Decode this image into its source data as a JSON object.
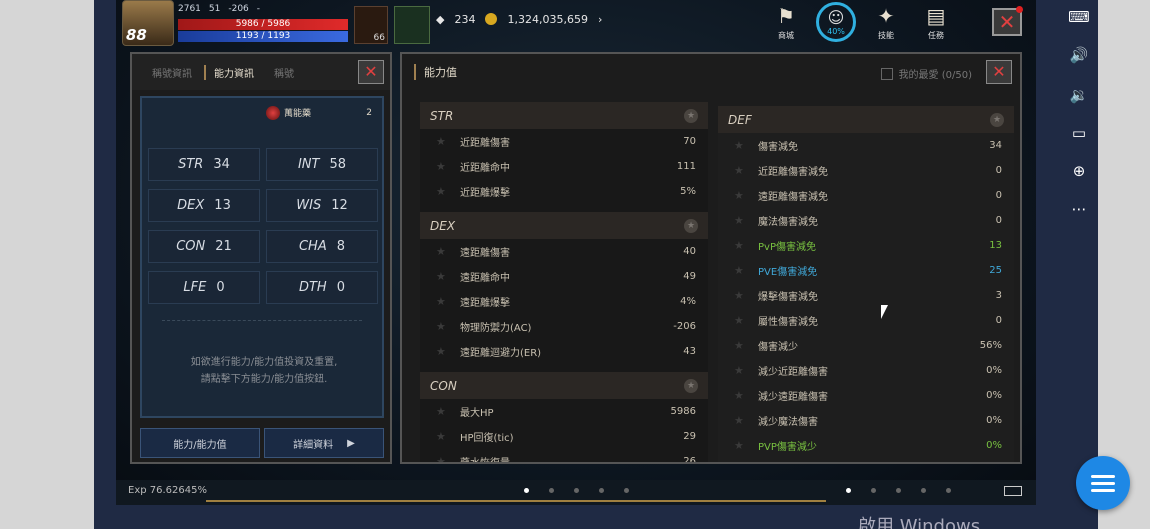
{
  "hud": {
    "level": "88",
    "stat1": "2761",
    "stat2": "51",
    "stat3": "-206",
    "stat4": "-",
    "hp": "5986 / 5986",
    "mp": "1193 / 1193",
    "potion_count": "66",
    "crystal": "234",
    "gold": "1,324,035,659",
    "menu": [
      {
        "label": "商城",
        "icon": "shop-icon"
      },
      {
        "label": "40%",
        "icon": "auto-icon"
      },
      {
        "label": "技能",
        "icon": "skill-icon"
      },
      {
        "label": "任務",
        "icon": "quest-icon"
      }
    ]
  },
  "left_panel": {
    "tabs": [
      "稱號資訊",
      "能力資訊",
      "稱號"
    ],
    "elixir_label": "萬能藥",
    "elixir_count": "2",
    "stats": [
      {
        "name": "STR",
        "value": "34"
      },
      {
        "name": "INT",
        "value": "58"
      },
      {
        "name": "DEX",
        "value": "13"
      },
      {
        "name": "WIS",
        "value": "12"
      },
      {
        "name": "CON",
        "value": "21"
      },
      {
        "name": "CHA",
        "value": "8"
      },
      {
        "name": "LFE",
        "value": "0"
      },
      {
        "name": "DTH",
        "value": "0"
      }
    ],
    "hint_line1": "如欲進行能力/能力值投資及重置,",
    "hint_line2": "請點擊下方能力/能力值按鈕.",
    "btn_ability": "能力/能力值",
    "btn_detail": "詳細資料"
  },
  "right_panel": {
    "title": "能力值",
    "favorites": "我的最愛 (0/50)",
    "str": {
      "title": "STR",
      "rows": [
        {
          "label": "近距離傷害",
          "value": "70"
        },
        {
          "label": "近距離命中",
          "value": "111"
        },
        {
          "label": "近距離爆擊",
          "value": "5%"
        }
      ]
    },
    "dex": {
      "title": "DEX",
      "rows": [
        {
          "label": "遠距離傷害",
          "value": "40"
        },
        {
          "label": "遠距離命中",
          "value": "49"
        },
        {
          "label": "遠距離爆擊",
          "value": "4%"
        },
        {
          "label": "物理防禦力(AC)",
          "value": "-206"
        },
        {
          "label": "遠距離迴避力(ER)",
          "value": "43"
        }
      ]
    },
    "con": {
      "title": "CON",
      "rows": [
        {
          "label": "最大HP",
          "value": "5986"
        },
        {
          "label": "HP回復(tic)",
          "value": "29"
        },
        {
          "label": "藥水恢復量",
          "value": "26"
        }
      ]
    },
    "def": {
      "title": "DEF",
      "rows": [
        {
          "label": "傷害減免",
          "value": "34",
          "color": "normal"
        },
        {
          "label": "近距離傷害減免",
          "value": "0",
          "color": "normal"
        },
        {
          "label": "遠距離傷害減免",
          "value": "0",
          "color": "normal"
        },
        {
          "label": "魔法傷害減免",
          "value": "0",
          "color": "normal"
        },
        {
          "label": "PvP傷害減免",
          "value": "13",
          "color": "green"
        },
        {
          "label": "PVE傷害減免",
          "value": "25",
          "color": "blue"
        },
        {
          "label": "爆擊傷害減免",
          "value": "3",
          "color": "normal"
        },
        {
          "label": "屬性傷害減免",
          "value": "0",
          "color": "normal"
        },
        {
          "label": "傷害減少",
          "value": "56%",
          "color": "normal"
        },
        {
          "label": "減少近距離傷害",
          "value": "0%",
          "color": "normal"
        },
        {
          "label": "減少遠距離傷害",
          "value": "0%",
          "color": "normal"
        },
        {
          "label": "減少魔法傷害",
          "value": "0%",
          "color": "normal"
        },
        {
          "label": "PVP傷害減少",
          "value": "0%",
          "color": "green"
        }
      ]
    }
  },
  "bottom": {
    "exp": "Exp 76.62645%"
  },
  "windows_text": "啟用 Windows"
}
